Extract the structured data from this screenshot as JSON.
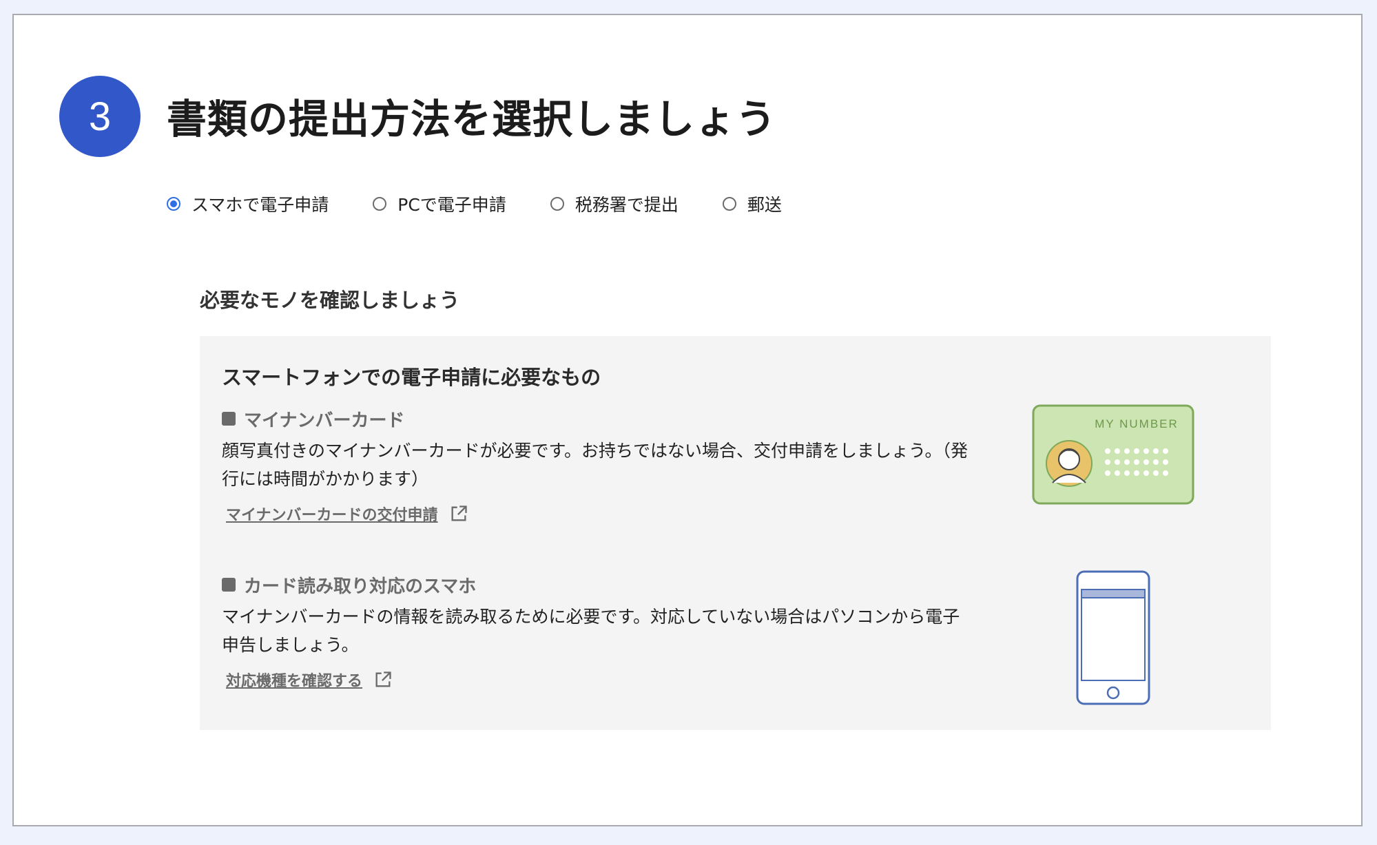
{
  "step": {
    "number": "3",
    "title": "書類の提出方法を選択しましょう"
  },
  "submission_methods": [
    {
      "label": "スマホで電子申請",
      "selected": true
    },
    {
      "label": "PCで電子申請",
      "selected": false
    },
    {
      "label": "税務署で提出",
      "selected": false
    },
    {
      "label": "郵送",
      "selected": false
    }
  ],
  "requirements": {
    "heading": "必要なモノを確認しましょう",
    "box_title": "スマートフォンでの電子申請に必要なもの",
    "items": [
      {
        "title": "マイナンバーカード",
        "description": "顔写真付きのマイナンバーカードが必要です。お持ちではない場合、交付申請をしましょう。（発行には時間がかかります）",
        "link": "マイナンバーカードの交付申請",
        "illustration_text": "MY NUMBER"
      },
      {
        "title": "カード読み取り対応のスマホ",
        "description": "マイナンバーカードの情報を読み取るために必要です。対応していない場合はパソコンから電子申告しましょう。",
        "link": "対応機種を確認する"
      }
    ]
  },
  "colors": {
    "accent": "#3157c9",
    "radio_selected": "#2f6fe6",
    "card_fill": "#cde4b3",
    "card_border": "#7ea85a",
    "phone_outline": "#4a6db5"
  }
}
